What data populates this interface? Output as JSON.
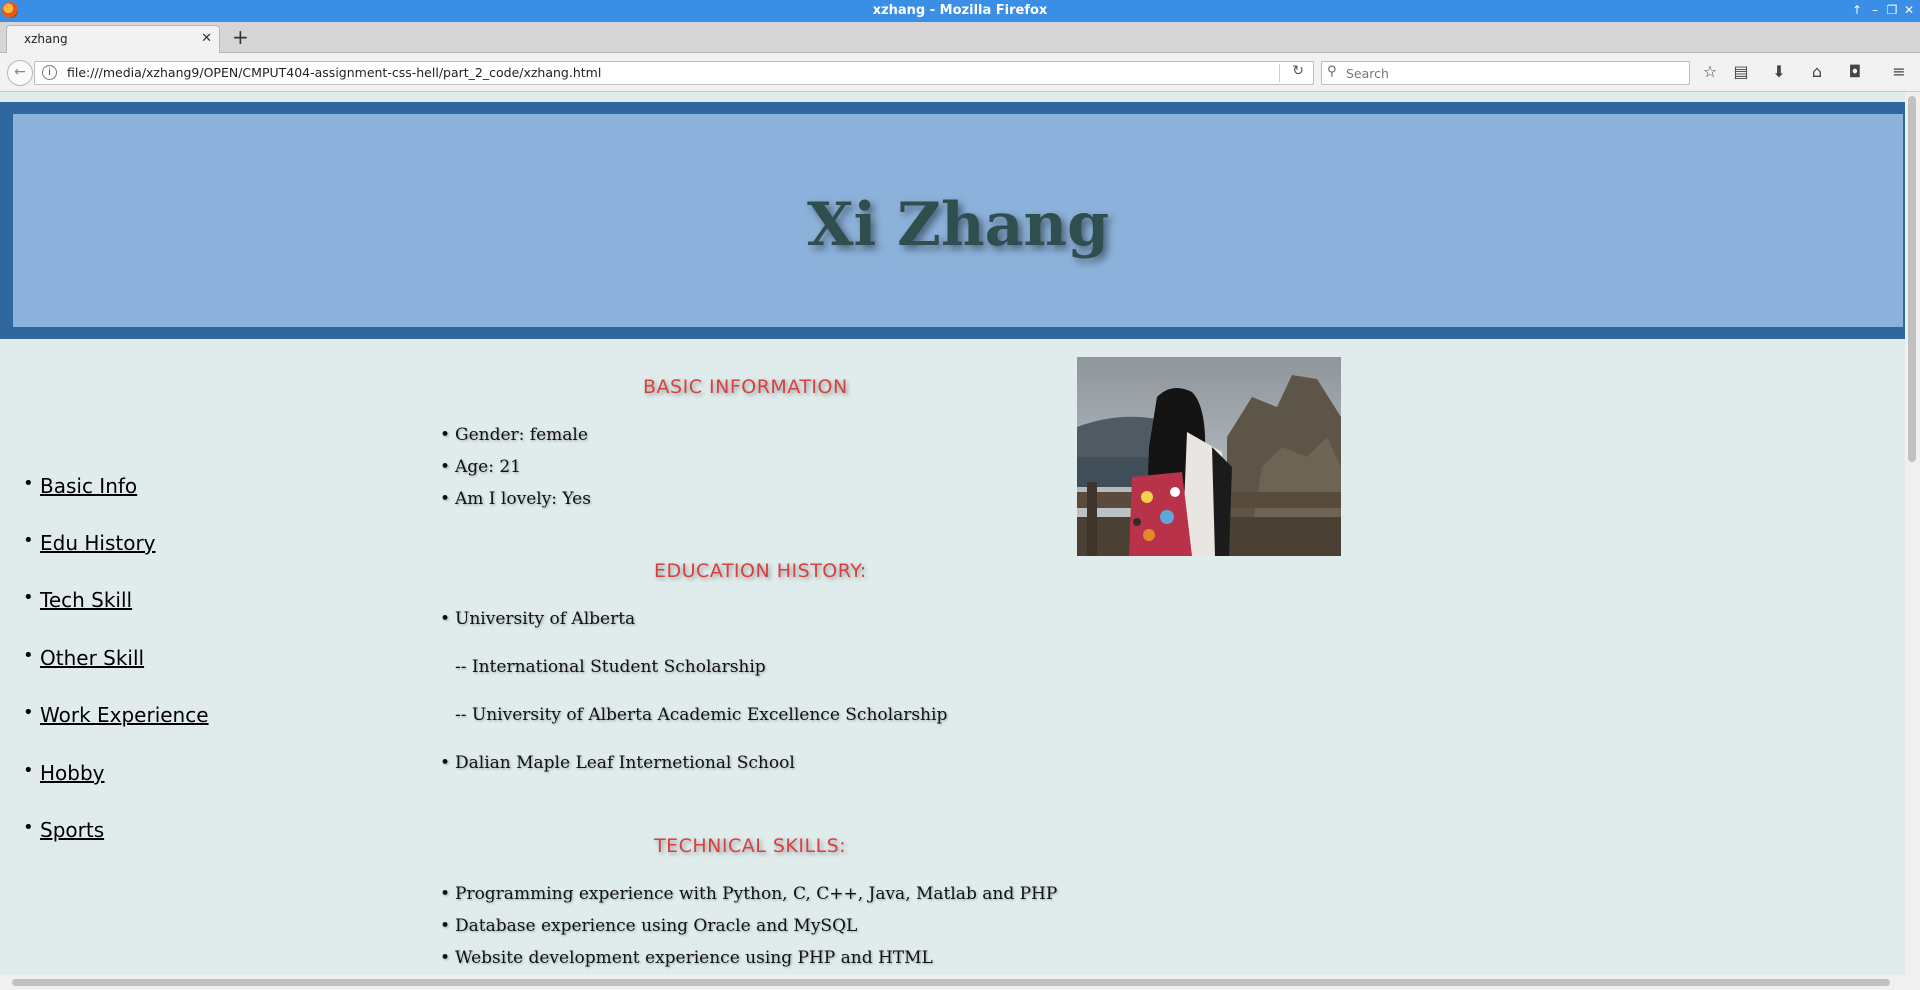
{
  "window": {
    "title": "xzhang - Mozilla Firefox"
  },
  "tabs": [
    {
      "label": "xzhang"
    }
  ],
  "navbar": {
    "url": "file:///media/xzhang9/OPEN/CMPUT404-assignment-css-hell/part_2_code/xzhang.html",
    "search_placeholder": "Search"
  },
  "page": {
    "name": "Xi Zhang",
    "nav_links": [
      "Basic Info",
      "Edu History",
      "Tech Skill",
      "Other Skill",
      "Work Experience",
      "Hobby",
      "Sports"
    ],
    "basic": {
      "heading": "BASIC INFORMATION",
      "items": [
        "Gender: female",
        "Age: 21",
        "Am I lovely: Yes"
      ]
    },
    "education": {
      "heading": "EDUCATION HISTORY:",
      "school1": "University of Alberta",
      "award1": "-- International Student Scholarship",
      "award2": "-- University of Alberta Academic Excellence Scholarship",
      "school2": "Dalian Maple Leaf Internetional School"
    },
    "technical": {
      "heading": "TECHNICAL SKILLS:",
      "items": [
        "Programming experience with Python, C, C++, Java, Matlab and PHP",
        "Database experience using Oracle and MySQL",
        "Website development experience using PHP and HTML"
      ]
    }
  },
  "colors": {
    "header_outer": "#2f679f",
    "header_inner": "#8cb2db",
    "page_bg": "#dfeceb",
    "heading_red": "#d94040",
    "title_text": "#2f4f4f"
  }
}
